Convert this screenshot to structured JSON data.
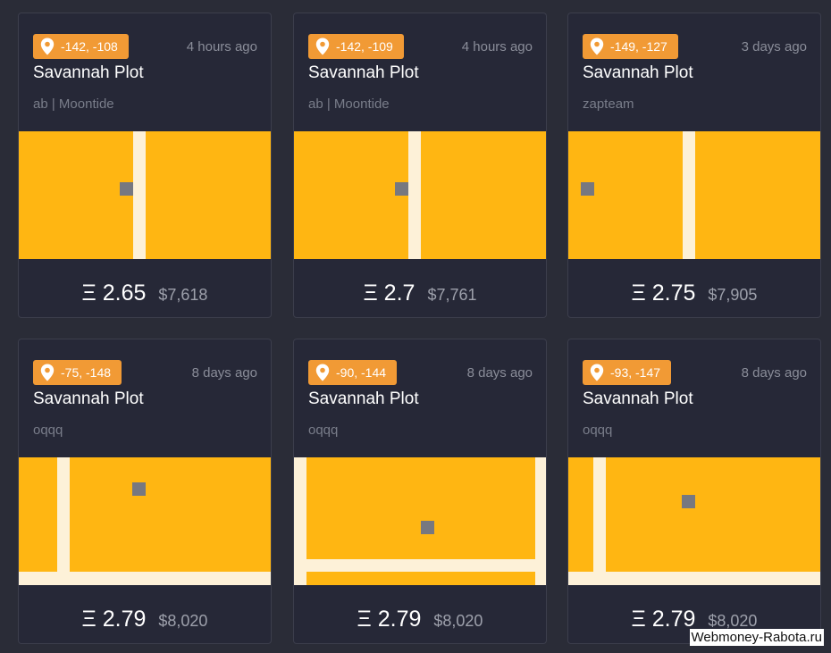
{
  "colors": {
    "badge": "#f19a35",
    "plot": "#ffb612",
    "road": "#fdf1d8",
    "marker": "#777880",
    "card": "#262837"
  },
  "cards": [
    {
      "coords": "-142, -108",
      "time": "4 hours ago",
      "title": "Savannah Plot",
      "owner": "ab | Moontide",
      "eth": "Ξ 2.65",
      "usd": "$7,618"
    },
    {
      "coords": "-142, -109",
      "time": "4 hours ago",
      "title": "Savannah Plot",
      "owner": "ab | Moontide",
      "eth": "Ξ 2.7",
      "usd": "$7,761"
    },
    {
      "coords": "-149, -127",
      "time": "3 days ago",
      "title": "Savannah Plot",
      "owner": "zapteam",
      "eth": "Ξ 2.75",
      "usd": "$7,905"
    },
    {
      "coords": "-75, -148",
      "time": "8 days ago",
      "title": "Savannah Plot",
      "owner": "oqqq",
      "eth": "Ξ 2.79",
      "usd": "$8,020"
    },
    {
      "coords": "-90, -144",
      "time": "8 days ago",
      "title": "Savannah Plot",
      "owner": "oqqq",
      "eth": "Ξ 2.79",
      "usd": "$8,020"
    },
    {
      "coords": "-93, -147",
      "time": "8 days ago",
      "title": "Savannah Plot",
      "owner": "oqqq",
      "eth": "Ξ 2.79",
      "usd": "$8,020"
    }
  ],
  "watermark": "Webmoney-Rabota.ru"
}
